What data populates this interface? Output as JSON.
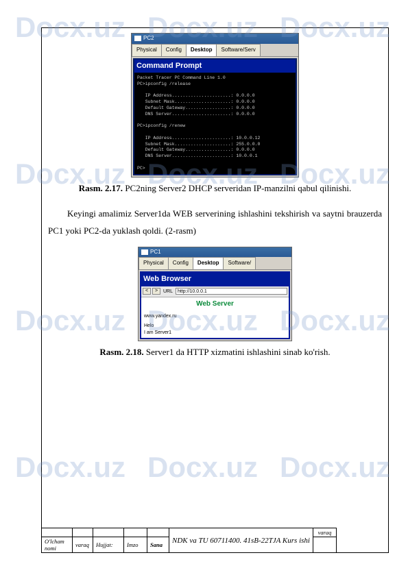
{
  "watermark": "Docx.uz",
  "screenshot1": {
    "window_title": "PC2",
    "tabs": [
      "Physical",
      "Config",
      "Desktop",
      "Software/Serv"
    ],
    "active_tab": "Desktop",
    "panel_title": "Command Prompt",
    "terminal": "Packet Tracer PC Command Line 1.0\nPC>ipconfig /release\n\n   IP Address......................: 0.0.0.0\n   Subnet Mask.....................: 0.0.0.0\n   Default Gateway.................: 0.0.0.0\n   DNS Server......................: 0.0.0.0\n\nPC>ipconfig /renew\n\n   IP Address......................: 10.0.0.12\n   Subnet Mask.....................: 255.0.0.0\n   Default Gateway.................: 0.0.0.0\n   DNS Server......................: 10.0.0.1\n\nPC>"
  },
  "caption1": {
    "label": "Rasm. 2.17.",
    "text": " PC2ning Server2 DHCP serveridan IP-manzilni qabul qilinishi."
  },
  "paragraph": "Keyingi amalimiz Server1da WEB serverining ishlashini tekshirish va saytni brauzerda PC1 yoki PC2-da yuklash qoldi. (2-rasm)",
  "screenshot2": {
    "window_title": "PC1",
    "tabs": [
      "Physical",
      "Config",
      "Desktop",
      "Software/"
    ],
    "active_tab": "Desktop",
    "panel_title": "Web Browser",
    "nav": {
      "back": "<",
      "forward": ">",
      "url_label": "URL",
      "url_value": "http://10.0.0.1"
    },
    "page_heading": "Web Server",
    "page_line1": "www.yandex.ru",
    "page_line2": "Helo",
    "page_line3": "I am Server1"
  },
  "caption2": {
    "label": "Rasm. 2.18.",
    "text": " Server1 da HTTP xizmatini ishlashini sinab ko'rish."
  },
  "footer": {
    "row2_c1": "O'lcham nomi",
    "row2_c2": "varaq",
    "row2_c3": "Hujjat:",
    "row2_c4": "Imzo",
    "row2_c5": "Sana",
    "title": "NDK va TU  60711400. 41sB-22TJA Kurs ishi",
    "varaq_label": "varaq"
  }
}
